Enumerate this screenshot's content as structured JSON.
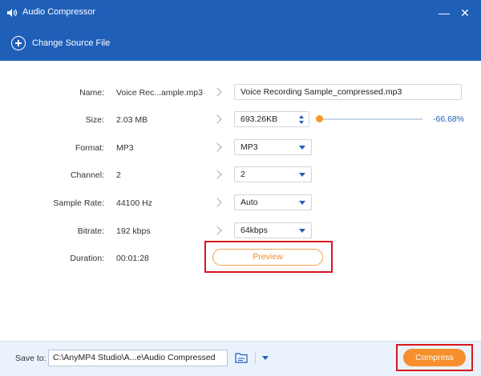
{
  "window": {
    "title": "Audio Compressor",
    "minimize_glyph": "—",
    "close_glyph": "✕"
  },
  "toolbar": {
    "change_source_label": "Change Source File"
  },
  "fields": {
    "name": {
      "label": "Name:",
      "value": "Voice Rec...ample.mp3",
      "output": "Voice Recording Sample_compressed.mp3"
    },
    "size": {
      "label": "Size:",
      "value": "2.03 MB",
      "output": "693.26KB",
      "slider_percent": "-66.68%"
    },
    "format": {
      "label": "Format:",
      "value": "MP3",
      "output": "MP3"
    },
    "channel": {
      "label": "Channel:",
      "value": "2",
      "output": "2"
    },
    "sample_rate": {
      "label": "Sample Rate:",
      "value": "44100 Hz",
      "output": "Auto"
    },
    "bitrate": {
      "label": "Bitrate:",
      "value": "192 kbps",
      "output": "64kbps"
    },
    "duration": {
      "label": "Duration:",
      "value": "00:01:28"
    }
  },
  "preview_label": "Preview",
  "footer": {
    "save_to_label": "Save to:",
    "save_path": "C:\\AnyMP4 Studio\\A...e\\Audio Compressed",
    "compress_label": "Compress"
  },
  "colors": {
    "brand_blue": "#1f5fb8",
    "accent_orange": "#f68f2c",
    "highlight_red": "#d91620"
  }
}
